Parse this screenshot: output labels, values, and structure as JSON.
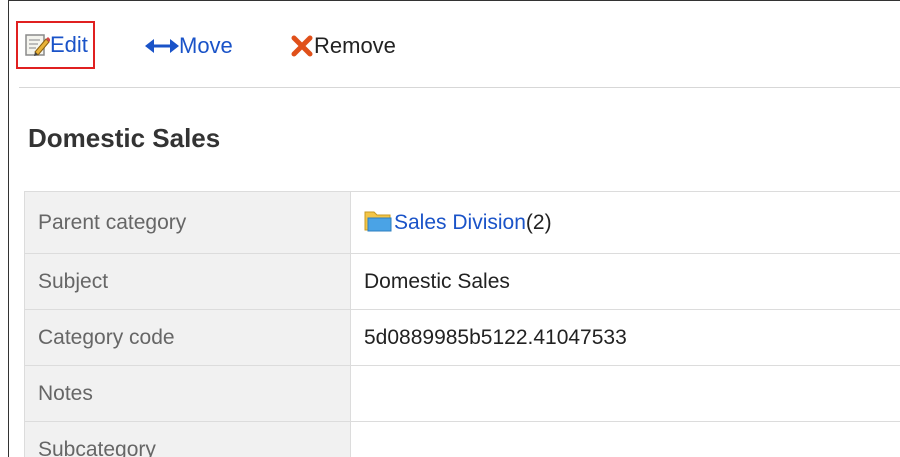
{
  "toolbar": {
    "edit_label": "Edit",
    "move_label": "Move",
    "remove_label": "Remove"
  },
  "category": {
    "title": "Domestic Sales"
  },
  "details": {
    "parent": {
      "label": "Parent category",
      "link": "Sales Division",
      "count": "(2)"
    },
    "subject": {
      "label": "Subject",
      "value": "Domestic Sales"
    },
    "code": {
      "label": "Category code",
      "value": "5d0889985b5122.41047533"
    },
    "notes": {
      "label": "Notes",
      "value": ""
    },
    "subcategory": {
      "label": "Subcategory",
      "value": ""
    }
  },
  "colors": {
    "link": "#1a53c8",
    "highlight": "#e02020",
    "remove_icon": "#e0501a",
    "label_bg": "#f1f1f1"
  },
  "icons": {
    "edit": "edit-pencil-icon",
    "move": "double-arrow-icon",
    "remove": "x-mark-icon",
    "parent": "folder-icon"
  }
}
